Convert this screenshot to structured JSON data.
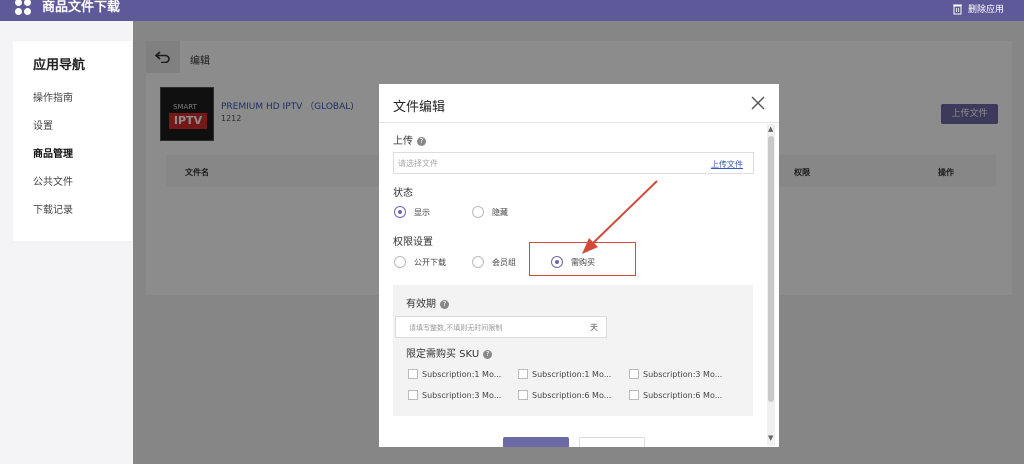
{
  "app": {
    "title": "商品文件下载",
    "delete_app": "删除应用"
  },
  "sidenav": {
    "title": "应用导航",
    "items": [
      "操作指南",
      "设置",
      "商品管理",
      "公共文件",
      "下载记录"
    ],
    "active": "商品管理"
  },
  "main": {
    "edit_label": "编辑",
    "product_name": "PREMIUM HD IPTV （GLOBAL)",
    "product_id": "1212",
    "thumb_smart": "SMART",
    "thumb_iptv": "IPTV",
    "upload_button": "上传文件",
    "columns": {
      "file_name": "文件名",
      "permission": "权限",
      "action": "操作"
    }
  },
  "modal": {
    "title": "文件编辑",
    "upload_label": "上传",
    "file_placeholder": "请选择文件",
    "upload_link": "上传文件",
    "status_label": "状态",
    "status_options": [
      "显示",
      "隐藏"
    ],
    "permission_label": "权限设置",
    "permission_options": [
      "公开下载",
      "会员组",
      "需购买"
    ],
    "validity_label": "有效期",
    "validity_placeholder": "请填写整数,不填则无时间限制",
    "validity_unit": "天",
    "sku_label": "限定需购买 SKU",
    "skus": [
      "Subscription:1 Mo...",
      "Subscription:1 Mo...",
      "Subscription:3 Mo...",
      "Subscription:3 Mo...",
      "Subscription:6 Mo...",
      "Subscription:6 Mo..."
    ]
  },
  "colors": {
    "brand": "#5e5a99",
    "accent": "#6d69a6",
    "highlight": "#d14a3a"
  }
}
